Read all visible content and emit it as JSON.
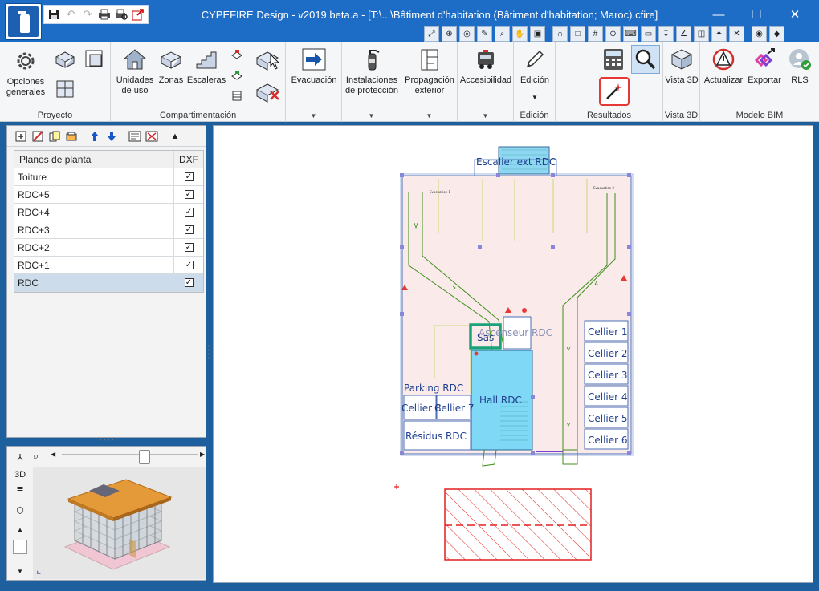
{
  "window": {
    "title": "CYPEFIRE Design - v2019.beta.a - [T:\\...\\Bâtiment d'habitation (Bâtiment d'habitation; Maroc).cfire]",
    "minimize": "—",
    "maximize": "☐",
    "close": "✕"
  },
  "quick_access": [
    "save-icon",
    "undo-icon",
    "redo-icon",
    "print-icon",
    "print-preview-icon",
    "export-icon"
  ],
  "ribbon": {
    "proyecto": {
      "label": "Proyecto",
      "opciones": "Opciones generales"
    },
    "compartimentacion": {
      "label": "Compartimentación",
      "unidades": "Unidades de uso",
      "zonas": "Zonas",
      "escaleras": "Escaleras"
    },
    "evacuacion": "Evacuación",
    "instalaciones": "Instalaciones de protección",
    "propagacion": "Propagación exterior",
    "accesibilidad": "Accesibilidad",
    "edicion": {
      "button": "Edición",
      "label": "Edición"
    },
    "resultados": {
      "label": "Resultados"
    },
    "vista3d": {
      "button": "Vista 3D",
      "label": "Vista 3D"
    },
    "bim": {
      "label": "Modelo BIM",
      "actualizar": "Actualizar",
      "exportar": "Exportar",
      "rls": "RLS"
    }
  },
  "floors": {
    "col_name": "Planos de planta",
    "col_dxf": "DXF",
    "rows": [
      {
        "name": "Toiture",
        "dxf": true
      },
      {
        "name": "RDC+5",
        "dxf": true
      },
      {
        "name": "RDC+4",
        "dxf": true
      },
      {
        "name": "RDC+3",
        "dxf": true
      },
      {
        "name": "RDC+2",
        "dxf": true
      },
      {
        "name": "RDC+1",
        "dxf": true
      },
      {
        "name": "RDC",
        "dxf": true,
        "selected": true
      }
    ]
  },
  "plan": {
    "escalier": "Escalier ext RDC",
    "ascenseur": "Ascenseur RDC",
    "sas": "Sas",
    "parking": "Parking RDC",
    "hall": "Hall RDC",
    "cellier8": "Cellier 8",
    "cellier7": "Cellier 7",
    "residus": "Résidus RDC",
    "celliers": [
      "Cellier 1",
      "Cellier 2",
      "Cellier 3",
      "Cellier 4",
      "Cellier 5",
      "Cellier 6"
    ],
    "evac1": "Evacuation 1",
    "evac2": "Evacuation 2"
  },
  "colors": {
    "titlebar": "#1d6cc5",
    "zone_fill": "#fbeaea",
    "hall_fill": "#7fd8f5",
    "label": "#1f3f8f",
    "route": "#3f8f1f",
    "hatch": "#e02020",
    "selection": "#1aa37a"
  }
}
